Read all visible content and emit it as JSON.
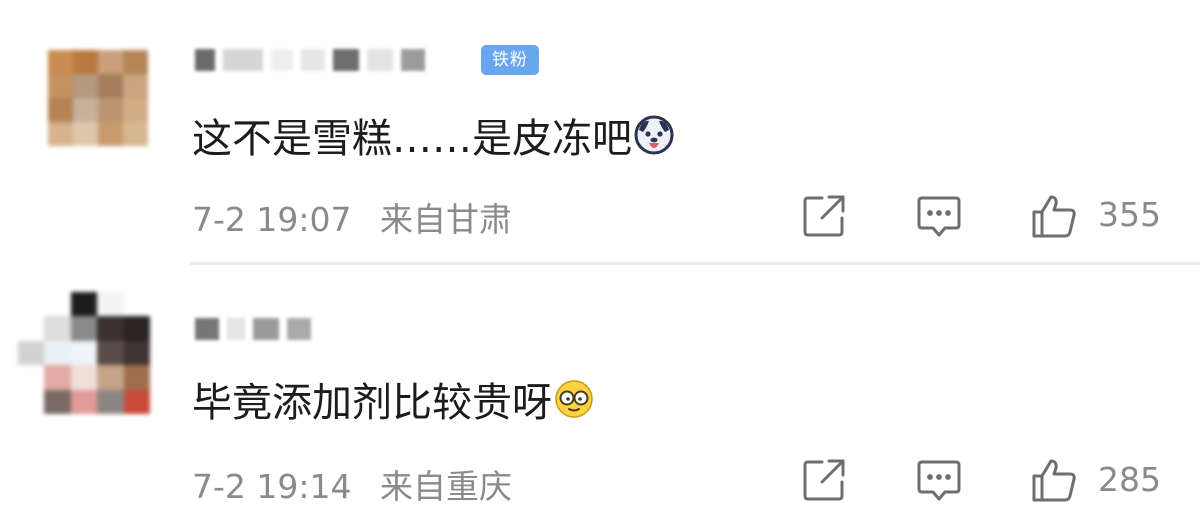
{
  "comments": [
    {
      "badge": "铁粉",
      "text": "这不是雪糕……是皮冻吧",
      "emoji": "dog-tongue-emoji",
      "time": "7-2 19:07",
      "location": "来自甘肃",
      "likes": "355"
    },
    {
      "text": "毕竟添加剂比较贵呀",
      "emoji": "glasses-face-emoji",
      "time": "7-2 19:14",
      "location": "来自重庆",
      "likes": "285"
    }
  ],
  "colors": {
    "badge_bg": "#6aa6ee",
    "text": "#1c1c1c",
    "meta": "#8a8a8a",
    "divider": "#ececec"
  }
}
